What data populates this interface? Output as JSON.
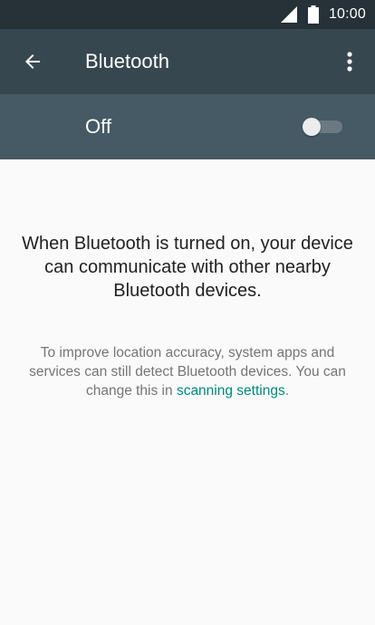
{
  "status_bar": {
    "time": "10:00",
    "icons": [
      "signal-icon",
      "battery-icon"
    ]
  },
  "app_bar": {
    "title": "Bluetooth",
    "icons": [
      "back-arrow-icon",
      "overflow-menu-icon"
    ]
  },
  "master_switch": {
    "label": "Off",
    "state": "off"
  },
  "content": {
    "main_text": "When Bluetooth is turned on, your device can communicate with other nearby Bluetooth devices.",
    "sub_text": "To improve location accuracy, system apps and services can still detect Bluetooth devices. You can change this in ",
    "link_text": "scanning settings",
    "sub_text_end": "."
  },
  "colors": {
    "status_bar": "#263238",
    "app_bar": "#37474f",
    "switch_bar": "#455a64",
    "background": "#fafafa",
    "link": "#00897b",
    "main_text": "#212121",
    "secondary_text": "#757575"
  }
}
